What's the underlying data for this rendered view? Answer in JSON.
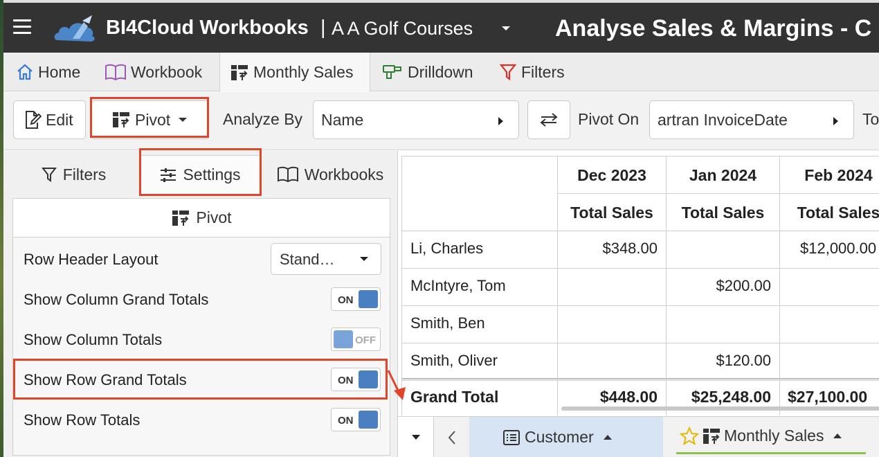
{
  "titlebar": {
    "app_name": "BI4Cloud Workbooks",
    "separator": "|",
    "company": "A A Golf Courses",
    "page_title": "Analyse Sales & Margins  - C"
  },
  "main_tabs": [
    {
      "label": "Home",
      "icon": "home-icon",
      "color": "#3a7bd5"
    },
    {
      "label": "Workbook",
      "icon": "book-icon",
      "color": "#9b59b6"
    },
    {
      "label": "Monthly Sales",
      "icon": "pivot-icon",
      "color": "#333333",
      "active": true
    },
    {
      "label": "Drilldown",
      "icon": "drill-icon",
      "color": "#2e7d32"
    },
    {
      "label": "Filters",
      "icon": "filter-icon",
      "color": "#d93025"
    }
  ],
  "toolbar": {
    "edit_label": "Edit",
    "pivot_label": "Pivot",
    "analyze_by_label": "Analyze By",
    "analyze_by_value": "Name",
    "pivot_on_label": "Pivot On",
    "pivot_on_value": "artran InvoiceDate",
    "trailing_label": "To"
  },
  "left_panel": {
    "tabs": [
      {
        "label": "Filters",
        "icon": "filter-icon"
      },
      {
        "label": "Settings",
        "icon": "sliders-icon",
        "active": true
      },
      {
        "label": "Workbooks",
        "icon": "book-icon"
      }
    ],
    "section_title": "Pivot",
    "settings": [
      {
        "label": "Row Header Layout",
        "type": "dropdown",
        "value": "Stand…"
      },
      {
        "label": "Show Column Grand Totals",
        "type": "toggle",
        "state": "ON"
      },
      {
        "label": "Show Column Totals",
        "type": "toggle",
        "state": "OFF"
      },
      {
        "label": "Show Row Grand Totals",
        "type": "toggle",
        "state": "ON"
      },
      {
        "label": "Show Row Totals",
        "type": "toggle",
        "state": "ON"
      }
    ]
  },
  "grid": {
    "months": [
      "Dec 2023",
      "Jan 2024",
      "Feb 2024"
    ],
    "measure": "Total Sales",
    "rows": [
      {
        "name": "Li, Charles",
        "values": [
          "$348.00",
          "",
          "$12,000.00"
        ]
      },
      {
        "name": "McIntyre, Tom",
        "values": [
          "",
          "$200.00",
          ""
        ]
      },
      {
        "name": "Smith, Ben",
        "values": [
          "",
          "",
          ""
        ]
      },
      {
        "name": "Smith, Oliver",
        "values": [
          "",
          "$120.00",
          ""
        ]
      }
    ],
    "total": {
      "name": "Grand Total",
      "values": [
        "$448.00",
        "$25,248.00",
        "$27,100.00"
      ]
    }
  },
  "sheet_tabs": [
    {
      "label": "Customer",
      "icon": "list-icon"
    },
    {
      "label": "Monthly Sales",
      "icon": "pivot-icon",
      "favorite": true,
      "active": true
    }
  ],
  "colors": {
    "titlebar_bg": "#333333",
    "highlight_red": "#e0452a",
    "toggle_blue": "#4a7fc1",
    "active_sheet_underline": "#8bc34a"
  }
}
